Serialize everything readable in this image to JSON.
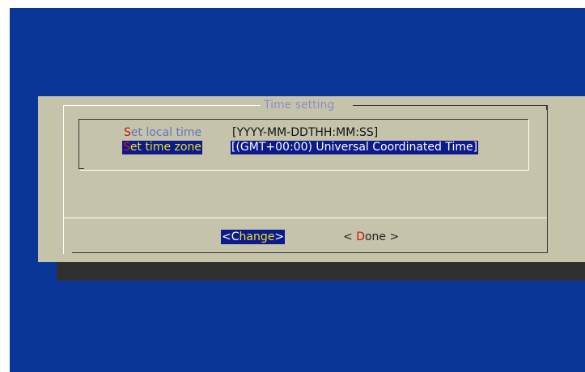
{
  "dialog": {
    "title": "Time setting",
    "fields": [
      {
        "hotkey": "S",
        "label_rest": "et local time",
        "value": "[YYYY-MM-DDTHH:MM:SS]"
      },
      {
        "hotkey": "S",
        "label_rest": "et time zone",
        "value": "[(GMT+00:00) Universal Coordinated Time]"
      }
    ],
    "buttons": {
      "change": {
        "open": "<C",
        "accent": "hange",
        "close": ">"
      },
      "done": {
        "open": "< ",
        "hotkey": "D",
        "rest": "one >"
      }
    }
  },
  "colors": {
    "screen_background": "#0a3797",
    "dialog_background": "#c5c4aa",
    "highlight_background": "#0c1a8c",
    "hotkey": "#c81414",
    "highlight_text": "#f0e020"
  }
}
